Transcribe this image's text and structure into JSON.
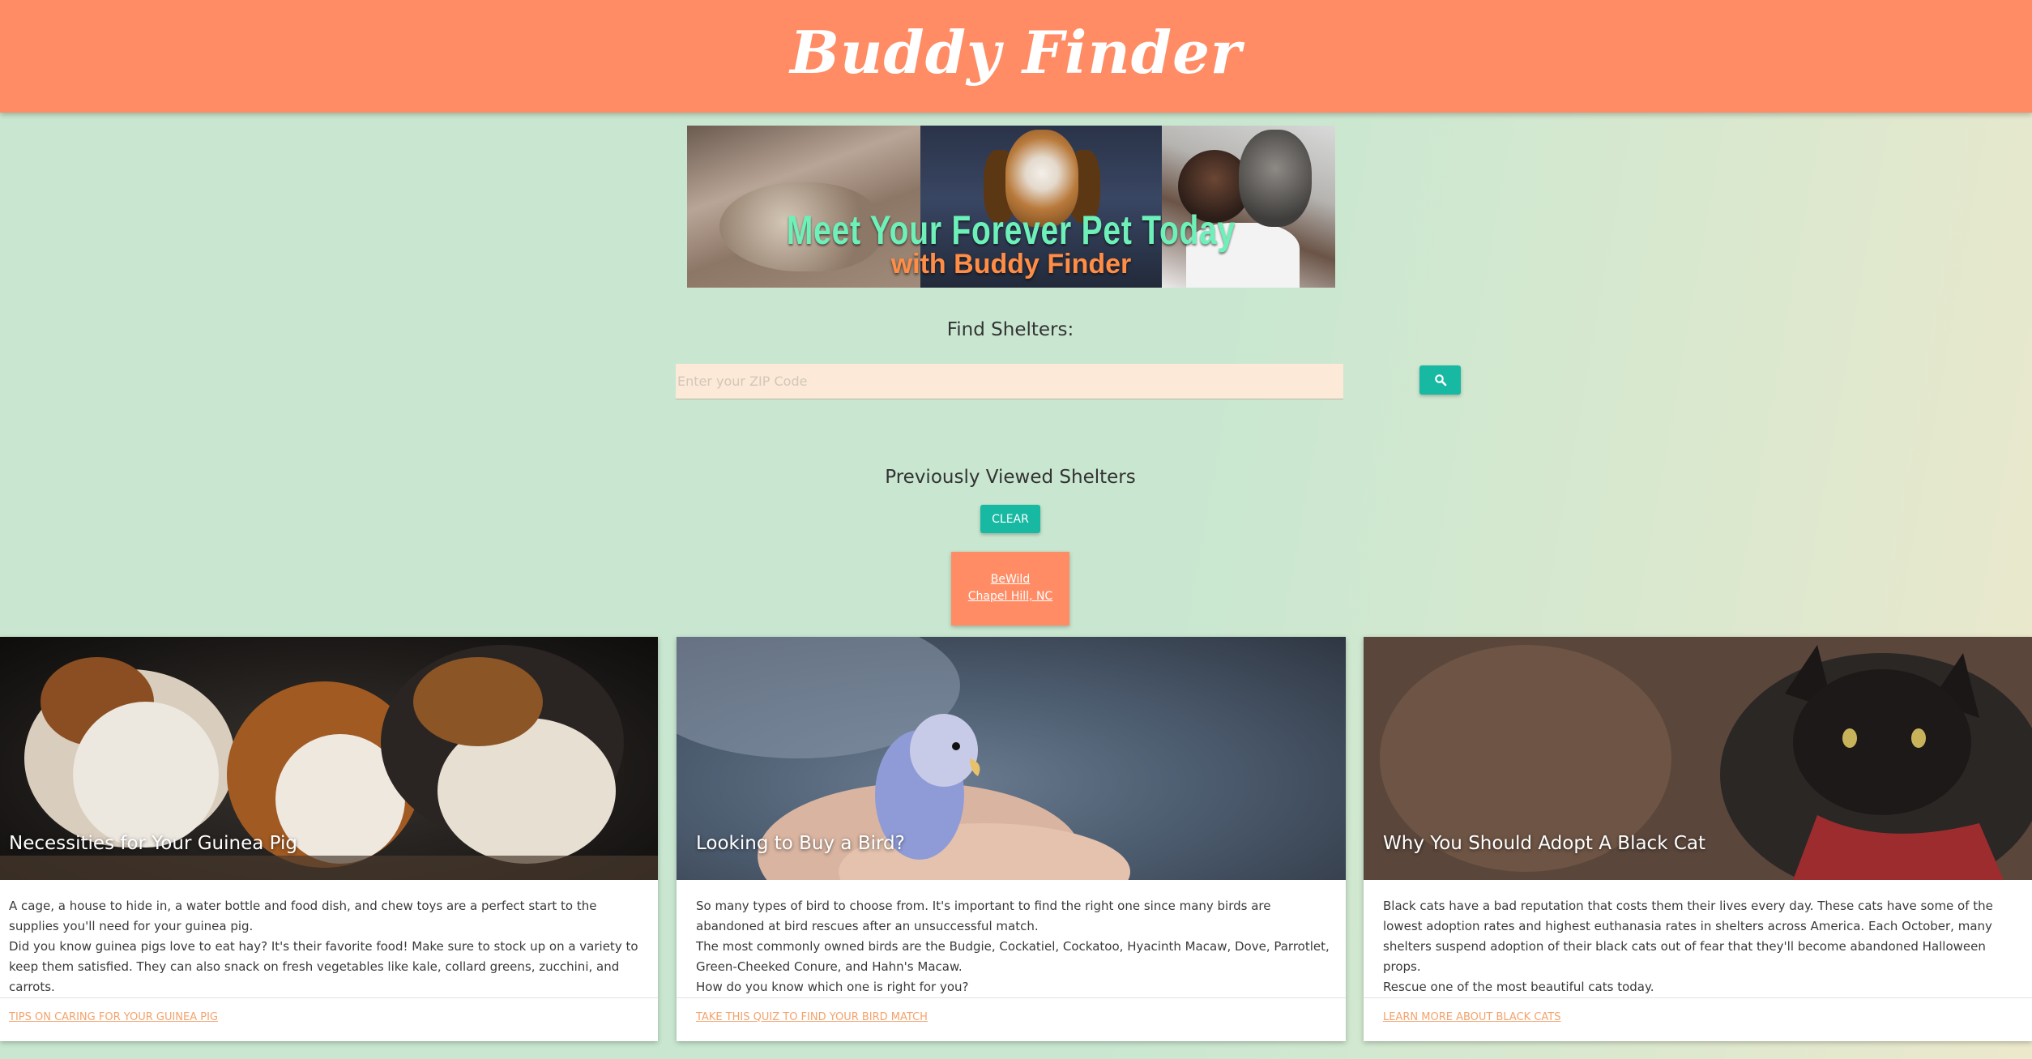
{
  "header": {
    "title": "Buddy Finder"
  },
  "banner": {
    "line1": "Meet Your Forever Pet Today",
    "line2": "with Buddy Finder",
    "line1_color": "#6ef0b9",
    "line2_color": "#ff8d45"
  },
  "search": {
    "label": "Find Shelters:",
    "placeholder": "Enter your ZIP Code",
    "button_icon": "search-icon"
  },
  "previous": {
    "title": "Previously Viewed Shelters",
    "clear_label": "CLEAR",
    "shelters": [
      {
        "name": "BeWild",
        "location": "Chapel Hill, NC"
      }
    ]
  },
  "articles": [
    {
      "title": "Necessities for Your Guinea Pig",
      "body": "A cage, a house to hide in, a water bottle and food dish, and chew toys are a perfect start to the supplies you'll need for your guinea pig.\nDid you know guinea pigs love to eat hay? It's their favorite food! Make sure to stock up on a variety to keep them satisfied. They can also snack on fresh vegetables like kale, collard greens, zucchini, and carrots.",
      "link": "TIPS ON CARING FOR YOUR GUINEA PIG"
    },
    {
      "title": "Looking to Buy a Bird?",
      "body": "So many types of bird to choose from. It's important to find the right one since many birds are abandoned at bird rescues after an unsuccessful match.\nThe most commonly owned birds are the Budgie, Cockatiel, Cockatoo, Hyacinth Macaw, Dove, Parrotlet, Green-Cheeked Conure, and Hahn's Macaw.\nHow do you know which one is right for you?",
      "link": "TAKE THIS QUIZ TO FIND YOUR BIRD MATCH"
    },
    {
      "title": "Why You Should Adopt A Black Cat",
      "body": "Black cats have a bad reputation that costs them their lives every day. These cats have some of the lowest adoption rates and highest euthanasia rates in shelters across America. Each October, many shelters suspend adoption of their black cats out of fear that they'll become abandoned Halloween props.\nRescue one of the most beautiful cats today.",
      "link": "LEARN MORE ABOUT BLACK CATS"
    }
  ],
  "colors": {
    "header_bg": "#ff8c65",
    "accent_teal": "#17b9a2",
    "page_bg": "#c9e7d0",
    "input_bg": "#fce9d7",
    "link_orange": "#f3a36d"
  }
}
